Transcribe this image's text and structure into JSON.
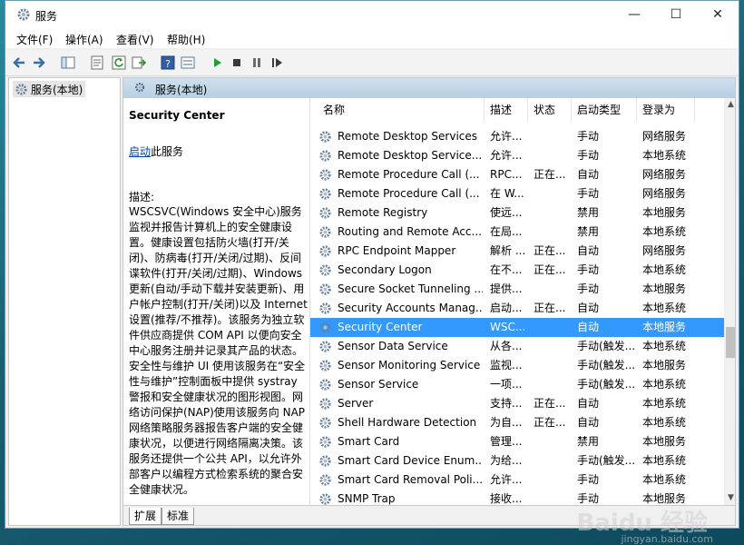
{
  "window": {
    "title": "服务",
    "controls": {
      "minimize": "—",
      "maximize": "☐",
      "close": "✕"
    }
  },
  "menu": [
    "文件(F)",
    "操作(A)",
    "查看(V)",
    "帮助(H)"
  ],
  "toolbar": {
    "icons": [
      "back-icon",
      "forward-icon",
      "show-tree-icon",
      "properties-icon",
      "refresh-icon",
      "export-icon",
      "help-icon",
      "view-icon",
      "play-icon",
      "stop-icon",
      "pause-icon",
      "restart-icon"
    ]
  },
  "tree": {
    "root_label": "服务(本地)"
  },
  "content": {
    "header_label": "服务(本地)"
  },
  "description": {
    "title": "Security Center",
    "start_link": "启动",
    "start_suffix": "此服务",
    "label": "描述:",
    "text": "WSCSVC(Windows 安全中心)服务监视并报告计算机上的安全健康设置。健康设置包括防火墙(打开/关闭)、防病毒(打开/关闭/过期)、反间谍软件(打开/关闭/过期)、Windows 更新(自动/手动下载并安装更新)、用户帐户控制(打开/关闭)以及 Internet 设置(推荐/不推荐)。该服务为独立软件供应商提供 COM API 以便向安全中心服务注册并记录其产品的状态。安全性与维护 UI 使用该服务在“安全性与维护”控制面板中提供 systray 警报和安全健康状况的图形视图。网络访问保护(NAP)使用该服务向 NAP 网络策略服务器报告客户端的安全健康状况，以便进行网络隔离决策。该服务还提供一个公共 API，以允许外部客户以编程方式检索系统的聚合安全健康状况。"
  },
  "columns": [
    "名称",
    "描述",
    "状态",
    "启动类型",
    "登录为"
  ],
  "services": [
    {
      "name": "Remote Desktop Services",
      "desc": "允许...",
      "status": "",
      "startup": "手动",
      "logon": "网络服务"
    },
    {
      "name": "Remote Desktop Service...",
      "desc": "允许...",
      "status": "",
      "startup": "手动",
      "logon": "本地系统"
    },
    {
      "name": "Remote Procedure Call (...",
      "desc": "RPC...",
      "status": "正在...",
      "startup": "自动",
      "logon": "网络服务"
    },
    {
      "name": "Remote Procedure Call (...",
      "desc": "在 W...",
      "status": "",
      "startup": "手动",
      "logon": "网络服务"
    },
    {
      "name": "Remote Registry",
      "desc": "使远...",
      "status": "",
      "startup": "禁用",
      "logon": "本地服务"
    },
    {
      "name": "Routing and Remote Acc...",
      "desc": "在局...",
      "status": "",
      "startup": "禁用",
      "logon": "本地系统"
    },
    {
      "name": "RPC Endpoint Mapper",
      "desc": "解析 ...",
      "status": "正在...",
      "startup": "自动",
      "logon": "网络服务"
    },
    {
      "name": "Secondary Logon",
      "desc": "在不...",
      "status": "正在...",
      "startup": "手动",
      "logon": "本地系统"
    },
    {
      "name": "Secure Socket Tunneling ...",
      "desc": "提供...",
      "status": "",
      "startup": "手动",
      "logon": "本地服务"
    },
    {
      "name": "Security Accounts Manag...",
      "desc": "启动...",
      "status": "正在...",
      "startup": "自动",
      "logon": "本地系统"
    },
    {
      "name": "Security Center",
      "desc": "WSC...",
      "status": "",
      "startup": "自动",
      "logon": "本地服务",
      "selected": true
    },
    {
      "name": "Sensor Data Service",
      "desc": "从各...",
      "status": "",
      "startup": "手动(触发...",
      "logon": "本地系统"
    },
    {
      "name": "Sensor Monitoring Service",
      "desc": "监视...",
      "status": "",
      "startup": "手动(触发...",
      "logon": "本地服务"
    },
    {
      "name": "Sensor Service",
      "desc": "一项...",
      "status": "",
      "startup": "手动(触发...",
      "logon": "本地系统"
    },
    {
      "name": "Server",
      "desc": "支持...",
      "status": "正在...",
      "startup": "自动",
      "logon": "本地系统"
    },
    {
      "name": "Shell Hardware Detection",
      "desc": "为自...",
      "status": "正在...",
      "startup": "自动",
      "logon": "本地系统"
    },
    {
      "name": "Smart Card",
      "desc": "管理...",
      "status": "",
      "startup": "禁用",
      "logon": "本地服务"
    },
    {
      "name": "Smart Card Device Enum...",
      "desc": "为给...",
      "status": "",
      "startup": "手动(触发...",
      "logon": "本地系统"
    },
    {
      "name": "Smart Card Removal Poli...",
      "desc": "允许...",
      "status": "",
      "startup": "手动",
      "logon": "本地系统"
    },
    {
      "name": "SNMP Trap",
      "desc": "接收...",
      "status": "",
      "startup": "手动",
      "logon": "本地服务"
    }
  ],
  "tabs": [
    "扩展",
    "标准"
  ],
  "watermark": {
    "main": "Baidu 经验",
    "sub": "jingyan.baidu.com"
  },
  "colors": {
    "selection": "#3399ff",
    "header_gradient": "#b7cfe2",
    "link": "#0645ad"
  }
}
